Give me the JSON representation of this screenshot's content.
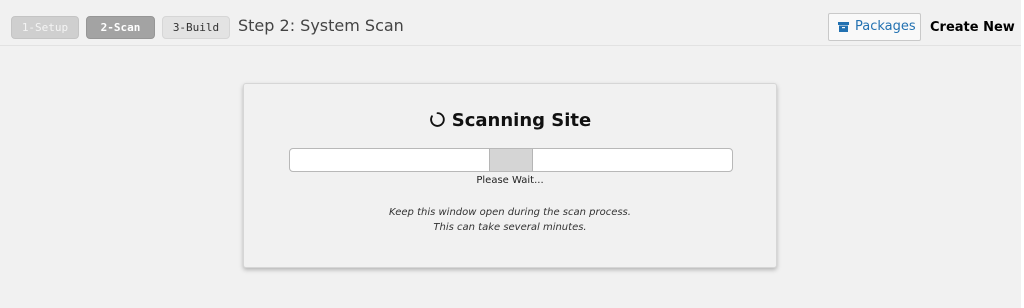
{
  "steps": [
    {
      "label": "1-Setup",
      "state": "completed"
    },
    {
      "label": "2-Scan",
      "state": "active"
    },
    {
      "label": "3-Build",
      "state": "pending"
    }
  ],
  "step_title": "Step 2: System Scan",
  "toolbar": {
    "packages_label": "Packages",
    "packages_icon": "archive-box-icon",
    "create_new_label": "Create New"
  },
  "scan": {
    "heading": "Scanning Site",
    "spinner_icon": "spinner-icon",
    "progress_indicator": {
      "type": "indeterminate",
      "fraction": 0.5
    },
    "wait_text": "Please Wait...",
    "note_lines": [
      "Keep this window open during the scan process.",
      "This can take several minutes."
    ]
  },
  "colors": {
    "link_accent": "#2271b1",
    "page_background": "#f1f1f1"
  }
}
